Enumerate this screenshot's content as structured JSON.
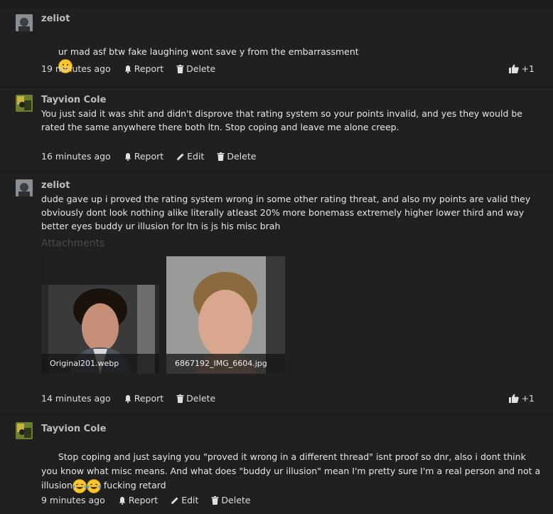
{
  "posts": [
    {
      "author": "zeliot",
      "text": "ur mad asf btw fake laughing wont save y from the embarrassment",
      "time": "19 minutes ago",
      "report": "Report",
      "delete": "Delete",
      "likes": "+1"
    },
    {
      "author": "Tayvion Cole",
      "text": "You just said it was shit and didn't disprove that rating system so your points invalid, and yes they would be rated the same anywhere there both ltn. Stop coping and leave me alone creep.",
      "time": "16 minutes ago",
      "report": "Report",
      "edit": "Edit",
      "delete": "Delete"
    },
    {
      "author": "zeliot",
      "text": "dude gave up i proved the rating system wrong in some other rating threat, and also my points are valid they obviously dont look nothing alike literally atleast 20% more bonemass extremely higher lower third and way better eyes buddy ur illusion for ltn is js his misc brah",
      "attachments_label": "Attachments",
      "attachments": [
        "Original201.webp",
        "6867192_IMG_6604.jpg"
      ],
      "time": "14 minutes ago",
      "report": "Report",
      "delete": "Delete",
      "likes": "+1"
    },
    {
      "author": "Tayvion Cole",
      "text_part1": "Stop coping and just saying you \"proved it wrong in a different thread\" isnt proof so dnr, also i dont think you know what misc means. And what does \"buddy ur illusion\" mean I'm pretty sure I'm a real person and not a illusion",
      "text_part2": " fucking retard",
      "time": "9 minutes ago",
      "report": "Report",
      "edit": "Edit",
      "delete": "Delete"
    }
  ],
  "colors": {
    "background": "#1c1c1c",
    "text": "#e6e6e6",
    "muted": "#4a4a4a"
  }
}
